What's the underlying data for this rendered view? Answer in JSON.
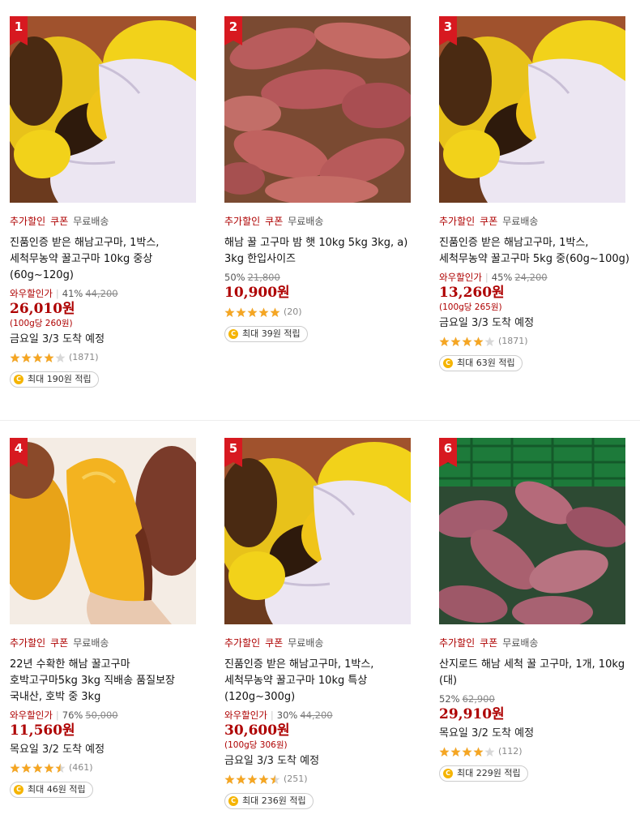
{
  "colors": {
    "accent": "#ae0000",
    "rank_badge": "#d71920",
    "star": "#f5a623",
    "coin": "#f5b400"
  },
  "products": [
    {
      "rank": "1",
      "badges": {
        "discount": "추가할인",
        "coupon": "쿠폰",
        "shipping": "무료배송"
      },
      "name": "진품인증 받은 해남고구마, 1박스, 세척무농약 꿀고구마 10kg 중상(60g~120g)",
      "wow_label": "와우할인가",
      "discount_rate": "41%",
      "original_price": "44,200",
      "price": "26,010원",
      "unit_price": "(100g당 260원)",
      "arrival": "금요일 3/3 도착 예정",
      "rating": 4,
      "review_count": "(1871)",
      "reward": "최대 190원 적립",
      "image": "baked-sweet-potato-glove"
    },
    {
      "rank": "2",
      "badges": {
        "discount": "추가할인",
        "coupon": "쿠폰",
        "shipping": "무료배송"
      },
      "name": "해남 꿀 고구마 밤 햇 10kg 5kg 3kg, a) 3kg 한입사이즈",
      "wow_label": "",
      "discount_rate": "50%",
      "original_price": "21,800",
      "price": "10,900원",
      "unit_price": "",
      "arrival": "",
      "rating": 5,
      "review_count": "(20)",
      "reward": "최대 39원 적립",
      "image": "raw-sweet-potato-pile"
    },
    {
      "rank": "3",
      "badges": {
        "discount": "추가할인",
        "coupon": "쿠폰",
        "shipping": "무료배송"
      },
      "name": "진품인증 받은 해남고구마, 1박스, 세척무농약 꿀고구마 5kg 중(60g~100g)",
      "wow_label": "와우할인가",
      "discount_rate": "45%",
      "original_price": "24,200",
      "price": "13,260원",
      "unit_price": "(100g당 265원)",
      "arrival": "금요일 3/3 도착 예정",
      "rating": 4,
      "review_count": "(1871)",
      "reward": "최대 63원 적립",
      "image": "baked-sweet-potato-glove"
    },
    {
      "rank": "4",
      "badges": {
        "discount": "추가할인",
        "coupon": "쿠폰",
        "shipping": "무료배송"
      },
      "name": "22년 수확한 해남 꿀고구마 호박고구마5kg 3kg 직배송 품질보장 국내산, 호박 중 3kg",
      "wow_label": "와우할인가",
      "discount_rate": "76%",
      "original_price": "50,000",
      "price": "11,560원",
      "unit_price": "",
      "arrival": "목요일 3/2 도착 예정",
      "rating": 4.5,
      "review_count": "(461)",
      "reward": "최대 46원 적립",
      "image": "pumpkin-sweet-potato-halved"
    },
    {
      "rank": "5",
      "badges": {
        "discount": "추가할인",
        "coupon": "쿠폰",
        "shipping": "무료배송"
      },
      "name": "진품인증 받은 해남고구마, 1박스, 세척무농약 꿀고구마 10kg 특상(120g~300g)",
      "wow_label": "와우할인가",
      "discount_rate": "30%",
      "original_price": "44,200",
      "price": "30,600원",
      "unit_price": "(100g당 306원)",
      "arrival": "금요일 3/3 도착 예정",
      "rating": 4.5,
      "review_count": "(251)",
      "reward": "최대 236원 적립",
      "image": "baked-sweet-potato-glove"
    },
    {
      "rank": "6",
      "badges": {
        "discount": "추가할인",
        "coupon": "쿠폰",
        "shipping": "무료배송"
      },
      "name": "산지로드 해남 세척 꿀 고구마, 1개, 10kg (대)",
      "wow_label": "",
      "discount_rate": "52%",
      "original_price": "62,900",
      "price": "29,910원",
      "unit_price": "",
      "arrival": "목요일 3/2 도착 예정",
      "rating": 4,
      "review_count": "(112)",
      "reward": "최대 229원 적립",
      "image": "sweet-potatoes-green-crate"
    }
  ]
}
